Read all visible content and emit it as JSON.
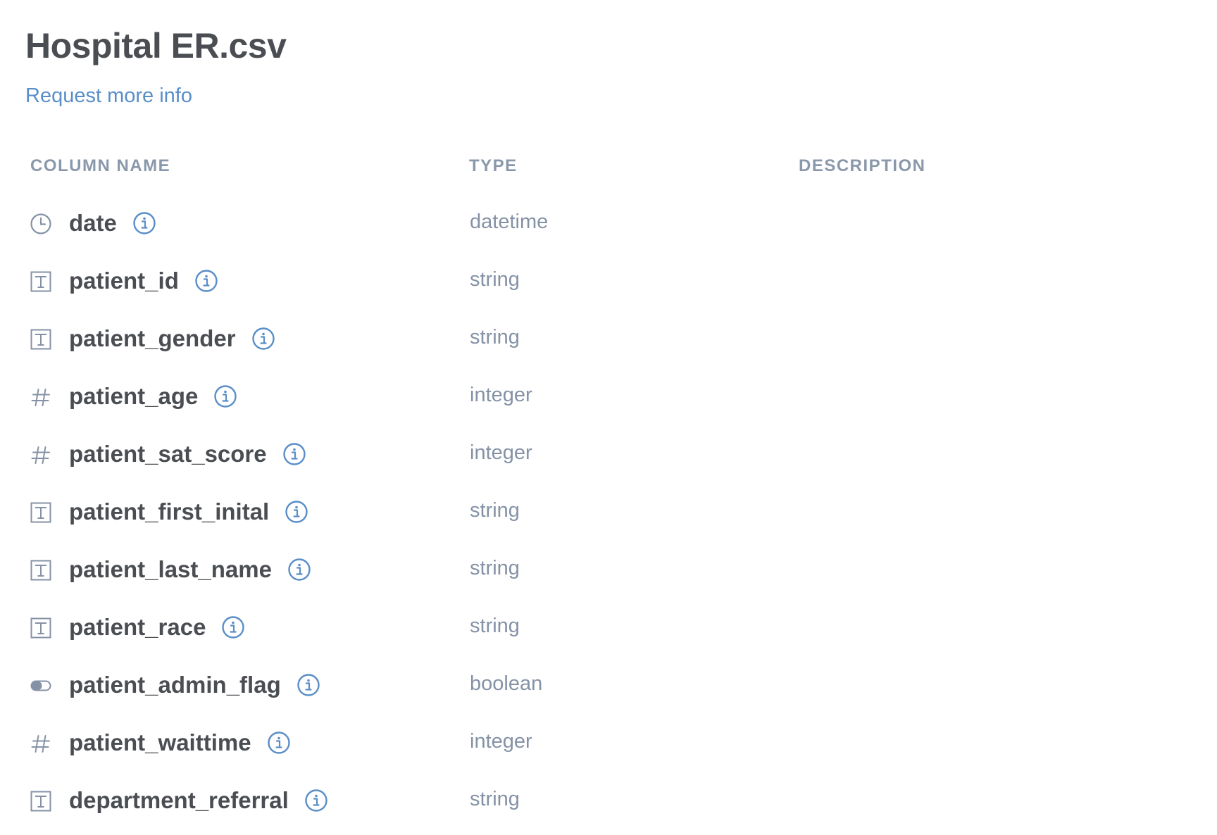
{
  "dataset": {
    "title": "Hospital ER.csv",
    "request_link": "Request more info"
  },
  "table": {
    "headers": {
      "column_name": "COLUMN NAME",
      "type": "TYPE",
      "description": "DESCRIPTION"
    },
    "rows": [
      {
        "name": "date",
        "type": "datetime",
        "icon": "clock-icon",
        "description": ""
      },
      {
        "name": "patient_id",
        "type": "string",
        "icon": "text-icon",
        "description": ""
      },
      {
        "name": "patient_gender",
        "type": "string",
        "icon": "text-icon",
        "description": ""
      },
      {
        "name": "patient_age",
        "type": "integer",
        "icon": "hash-icon",
        "description": ""
      },
      {
        "name": "patient_sat_score",
        "type": "integer",
        "icon": "hash-icon",
        "description": ""
      },
      {
        "name": "patient_first_inital",
        "type": "string",
        "icon": "text-icon",
        "description": ""
      },
      {
        "name": "patient_last_name",
        "type": "string",
        "icon": "text-icon",
        "description": ""
      },
      {
        "name": "patient_race",
        "type": "string",
        "icon": "text-icon",
        "description": ""
      },
      {
        "name": "patient_admin_flag",
        "type": "boolean",
        "icon": "toggle-icon",
        "description": ""
      },
      {
        "name": "patient_waittime",
        "type": "integer",
        "icon": "hash-icon",
        "description": ""
      },
      {
        "name": "department_referral",
        "type": "string",
        "icon": "text-icon",
        "description": ""
      }
    ]
  },
  "colors": {
    "title": "#4a4d52",
    "link": "#5a8ec8",
    "header": "#8a98ab",
    "muted": "#8592a6",
    "info_icon": "#5a8ec8"
  }
}
